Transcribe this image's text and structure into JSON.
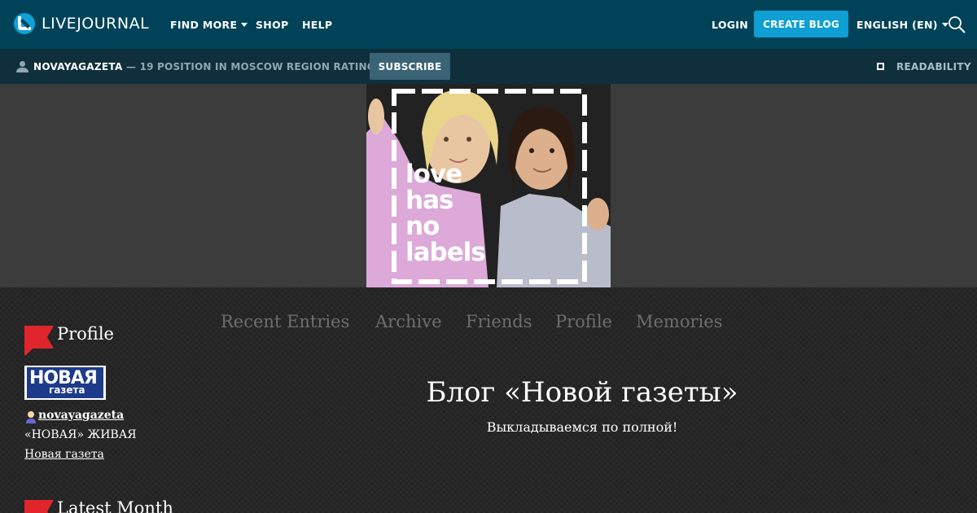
{
  "topbar": {
    "logo_text": "LIVEJOURNAL",
    "nav": [
      {
        "label": "FIND MORE"
      },
      {
        "label": "SHOP"
      },
      {
        "label": "HELP"
      }
    ],
    "login": "LOGIN",
    "create_blog": "CREATE BLOG",
    "language": "ENGLISH (EN)"
  },
  "subbar": {
    "journal": "NOVAYAGAZETA",
    "rating": "— 19 POSITION IN MOSCOW REGION RATING",
    "subscribe": "SUBSCRIBE",
    "readability": "READABILITY"
  },
  "banner": {
    "lines": [
      "love",
      "has",
      "no",
      "labels"
    ]
  },
  "sidebar": {
    "profile_title": "Profile",
    "logo_text_top": "НОВАЯ",
    "logo_text_bottom": "газета",
    "username": "novayagazeta",
    "tagline": "«НОВАЯ» ЖИВАЯ",
    "link": "Новая газета",
    "latest_title": "Latest Month"
  },
  "tabs": [
    {
      "label": "Recent Entries"
    },
    {
      "label": "Archive"
    },
    {
      "label": "Friends"
    },
    {
      "label": "Profile"
    },
    {
      "label": "Memories"
    }
  ],
  "blog": {
    "title": "Блог «Новой газеты»",
    "subtitle": "Выкладываемся по полной!"
  },
  "colors": {
    "topbar_bg": "#004359",
    "subbar_bg": "#0f2f3c",
    "accent_button": "#0f9fd3",
    "flag_red": "#e0252c"
  }
}
